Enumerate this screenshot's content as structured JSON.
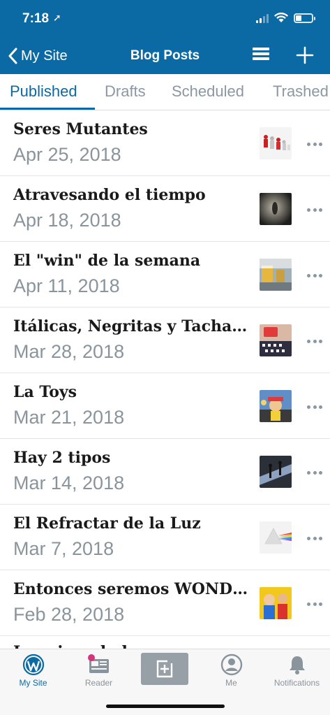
{
  "status_bar": {
    "time": "7:18",
    "location_glyph": "➚"
  },
  "nav": {
    "back_label": "My Site",
    "title": "Blog Posts"
  },
  "tabs": [
    {
      "label": "Published",
      "active": true
    },
    {
      "label": "Drafts",
      "active": false
    },
    {
      "label": "Scheduled",
      "active": false
    },
    {
      "label": "Trashed",
      "active": false
    }
  ],
  "posts": [
    {
      "title": "Seres Mutantes",
      "date": "Apr 25, 2018"
    },
    {
      "title": "Atravesando el tiempo",
      "date": "Apr 18, 2018"
    },
    {
      "title": "El \"win\" de la semana",
      "date": "Apr 11, 2018"
    },
    {
      "title": "Itálicas, Negritas y Tachadas",
      "date": "Mar 28, 2018"
    },
    {
      "title": "La Toys",
      "date": "Mar 21, 2018"
    },
    {
      "title": "Hay 2 tipos",
      "date": "Mar 14, 2018"
    },
    {
      "title": "El Refractar de la Luz",
      "date": "Mar 7, 2018"
    },
    {
      "title": "Entonces seremos WONDER",
      "date": "Feb 28, 2018"
    },
    {
      "title": "Imaginando la...",
      "date": ""
    }
  ],
  "tab_bar": {
    "my_site": "My Site",
    "reader": "Reader",
    "me": "Me",
    "notifications": "Notifications"
  },
  "colors": {
    "brand_blue": "#0b6aa3",
    "reader_badge": "#d4367e"
  }
}
